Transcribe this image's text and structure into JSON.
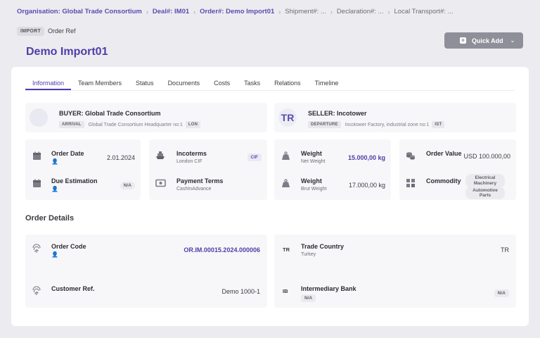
{
  "breadcrumb": [
    {
      "label": "Organisation: Global Trade Consortium",
      "active": true
    },
    {
      "label": "Deal#: IM01",
      "active": true
    },
    {
      "label": "Order#: Demo Import01",
      "active": true
    },
    {
      "label": "Shipment#: ...",
      "active": false
    },
    {
      "label": "Declaration#: ...",
      "active": false
    },
    {
      "label": "Local Transport#: ...",
      "active": false
    }
  ],
  "header": {
    "type_badge": "IMPORT",
    "order_ref_label": "Order Ref",
    "title": "Demo Import01",
    "quick_add": "Quick Add"
  },
  "tabs": [
    "Information",
    "Team Members",
    "Status",
    "Documents",
    "Costs",
    "Tasks",
    "Relations",
    "Timeline"
  ],
  "buyer": {
    "title": "BUYER: Global Trade Consortium",
    "tag": "ARRIVAL",
    "address": "Global Trade Consortium Headquarter no:1",
    "code": "LON"
  },
  "seller": {
    "avatar": "TR",
    "title": "SELLER: Incotower",
    "tag": "DEPARTURE",
    "address": "Incotower Factory, industrial zone no:1",
    "code": "IST"
  },
  "order_date": {
    "label": "Order Date",
    "value": "2.01.2024"
  },
  "due_estimation": {
    "label": "Due Estimation",
    "value": "N/A"
  },
  "incoterms": {
    "label": "Incoterms",
    "sub": "London CIF",
    "chip": "CIF"
  },
  "payment_terms": {
    "label": "Payment Terms",
    "sub": "CashInAdvance"
  },
  "weight_net": {
    "label": "Weight",
    "sub": "Net Weight",
    "value": "15.000,00 kg"
  },
  "weight_brut": {
    "label": "Weight",
    "sub": "Brut Weight",
    "value": "17.000,00 kg"
  },
  "order_value": {
    "label": "Order Value",
    "value": "USD 100.000,00"
  },
  "commodity": {
    "label": "Commodity",
    "chips": [
      "Electrical Machinery",
      "Automotive Parts"
    ]
  },
  "order_details": {
    "title": "Order Details",
    "order_code": {
      "label": "Order Code",
      "value": "OR.IM.00015.2024.000006"
    },
    "customer_ref": {
      "label": "Customer Ref.",
      "value": "Demo 1000-1"
    },
    "trade_country": {
      "icon_text": "TR",
      "label": "Trade Country",
      "sub": "Turkey",
      "value": "TR"
    },
    "intermediary_bank": {
      "icon_text": "IB",
      "label": "Intermediary Bank",
      "sub": "N/A",
      "value": "N/A"
    }
  }
}
